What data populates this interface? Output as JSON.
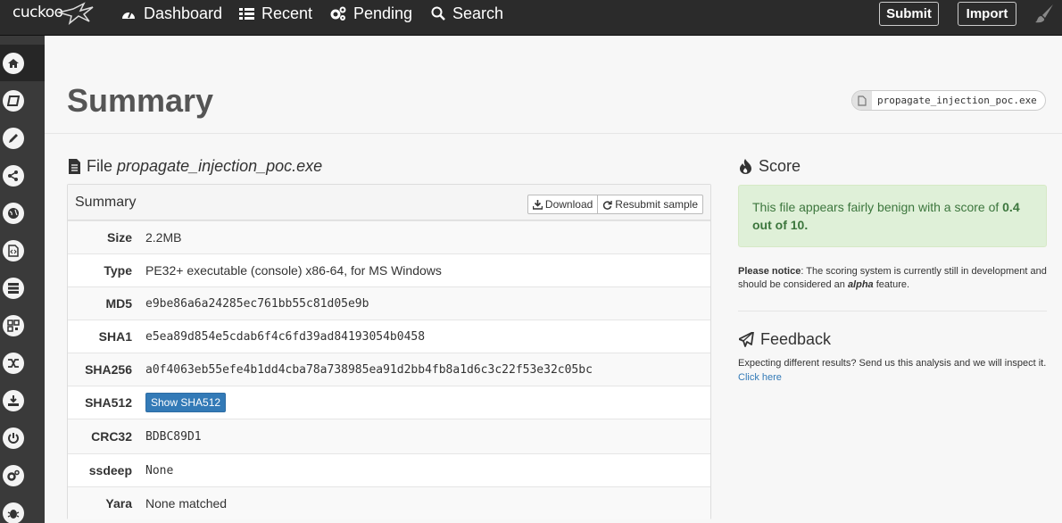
{
  "nav": {
    "logo": "cuckoo",
    "items": [
      {
        "label": "Dashboard",
        "icon": "dashboard-icon"
      },
      {
        "label": "Recent",
        "icon": "list-icon"
      },
      {
        "label": "Pending",
        "icon": "cogs-icon"
      },
      {
        "label": "Search",
        "icon": "search-icon"
      }
    ],
    "submit": "Submit",
    "import": "Import",
    "theme_icon": "paintbrush-icon"
  },
  "sidebar": {
    "icons": [
      "home-icon",
      "book-icon",
      "pencil-icon",
      "share-icon",
      "globe-icon",
      "code-file-icon",
      "server-icon",
      "qrcode-icon",
      "shuffle-icon",
      "download-icon",
      "power-icon",
      "cogs-icon",
      "bug-icon"
    ]
  },
  "header": {
    "title": "Summary",
    "file_badge": "propagate_injection_poc.exe"
  },
  "file": {
    "heading_prefix": "File",
    "filename": "propagate_injection_poc.exe",
    "panel_title": "Summary",
    "download": "Download",
    "resubmit": "Resubmit sample",
    "rows": {
      "size": {
        "key": "Size",
        "value": "2.2MB"
      },
      "type": {
        "key": "Type",
        "value": "PE32+ executable (console) x86-64, for MS Windows"
      },
      "md5": {
        "key": "MD5",
        "value": "e9be86a6a24285ec761bb55c81d05e9b"
      },
      "sha1": {
        "key": "SHA1",
        "value": "e5ea89d854e5cdab6f4c6fd39ad84193054b0458"
      },
      "sha256": {
        "key": "SHA256",
        "value": "a0f4063eb55efe4b1dd4cba78a738985ea91d2bb4fb8a1d6c3c22f53e32c05bc"
      },
      "sha512": {
        "key": "SHA512",
        "button": "Show SHA512"
      },
      "crc32": {
        "key": "CRC32",
        "value": "BDBC89D1"
      },
      "ssdeep": {
        "key": "ssdeep",
        "value": "None"
      },
      "yara": {
        "key": "Yara",
        "value": "None matched"
      }
    }
  },
  "score": {
    "heading": "Score",
    "text_before": "This file appears fairly benign with a score of ",
    "value": "0.4 out of 10.",
    "notice_label": "Please notice",
    "notice_text_1": ": The scoring system is currently still in development and should be considered an ",
    "notice_em": "alpha",
    "notice_text_2": " feature."
  },
  "feedback": {
    "heading": "Feedback",
    "text": "Expecting different results? Send us this analysis and we will inspect it.",
    "link": "Click here"
  },
  "colors": {
    "navbar": "#2b2b2b",
    "sidebar": "#3a3a3a",
    "success_bg": "#dff0d8",
    "success_text": "#3c763d",
    "primary": "#337ab7"
  }
}
